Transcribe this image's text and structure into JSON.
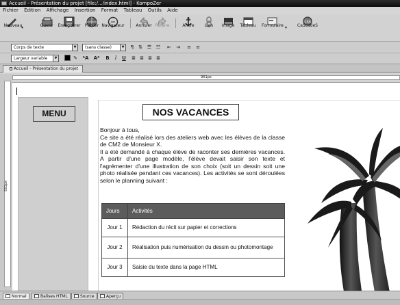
{
  "window": {
    "title": "Accueil - Présentation du projet [file:/.../index.html] - KompoZer"
  },
  "menubar": {
    "items": [
      "Fichier",
      "Édition",
      "Affichage",
      "Insertion",
      "Format",
      "Tableau",
      "Outils",
      "Aide"
    ]
  },
  "toolbar": {
    "new": "Nouveau",
    "open": "Ouvrir",
    "save": "Enregistrer",
    "publish": "Publier",
    "browse": "Navigateur",
    "undo": "Annuler",
    "redo": "Refaire",
    "anchor": "Ancre",
    "link": "Lien",
    "image": "Image",
    "table": "Tableau",
    "form": "Formulaire",
    "cascades": "CaScadeS"
  },
  "format_toolbar": {
    "paragraph_format": "Corps de texte",
    "class": "(sans classe)",
    "font": "Largeur variable"
  },
  "tabs": {
    "document": "Accueil - Présentation du projet"
  },
  "ruler": {
    "width_label": "961px",
    "height_label": "551px"
  },
  "page": {
    "menu_label": "MENU",
    "heading": "NOS VACANCES",
    "para1": "Bonjour à tous,",
    "para2": "Ce site a été réalisé lors des ateliers web avec les élèves de la classe de CM2 de Monsieur X.",
    "para3": "Il a été demandé à chaque élève de raconter ses dernières vacances. A partir d'une page modèle, l'élève devait saisir son texte et l'agrémenter d'une illustration de son choix (soit un dessin soit une photo réalisée pendant ces vacances). Les activités se sont déroulées selon le planning suivant :",
    "table": {
      "headers": [
        "Jours",
        "Activités"
      ],
      "rows": [
        [
          "Jour 1",
          "Rédaction du récit sur papier et corrections"
        ],
        [
          "Jour 2",
          "Réalisation puis numérisation du dessin ou photomontage"
        ],
        [
          "Jour 3",
          "Saisie du texte dans la page HTML"
        ]
      ]
    }
  },
  "view_tabs": {
    "normal": "Normal",
    "html_tags": "Balises HTML",
    "source": "Source",
    "preview": "Aperçu"
  }
}
